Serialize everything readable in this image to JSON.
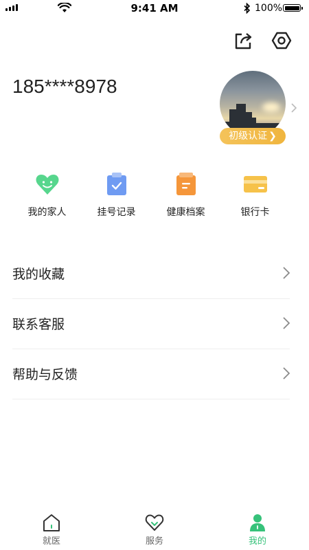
{
  "status_bar": {
    "time": "9:41 AM",
    "battery": "100%"
  },
  "header": {
    "icons": [
      "share-icon",
      "settings-icon"
    ]
  },
  "profile": {
    "phone": "185****8978",
    "cert_label": "初级认证",
    "cert_chevron": "❯"
  },
  "quick_actions": [
    {
      "label": "我的家人",
      "icon": "family-heart-icon",
      "color": "#57d68d"
    },
    {
      "label": "挂号记录",
      "icon": "registration-clipboard-icon",
      "color": "#6f9bf2"
    },
    {
      "label": "健康档案",
      "icon": "health-record-icon",
      "color": "#f5963a"
    },
    {
      "label": "银行卡",
      "icon": "bank-card-icon",
      "color": "#f6c24a"
    }
  ],
  "menu": [
    {
      "label": "我的收藏"
    },
    {
      "label": "联系客服"
    },
    {
      "label": "帮助与反馈"
    }
  ],
  "tabbar": [
    {
      "label": "就医",
      "icon": "home-icon",
      "active": false
    },
    {
      "label": "服务",
      "icon": "heart-service-icon",
      "active": false
    },
    {
      "label": "我的",
      "icon": "person-icon",
      "active": true
    }
  ],
  "colors": {
    "accent": "#36c27a",
    "badge": "#f0b53e"
  }
}
